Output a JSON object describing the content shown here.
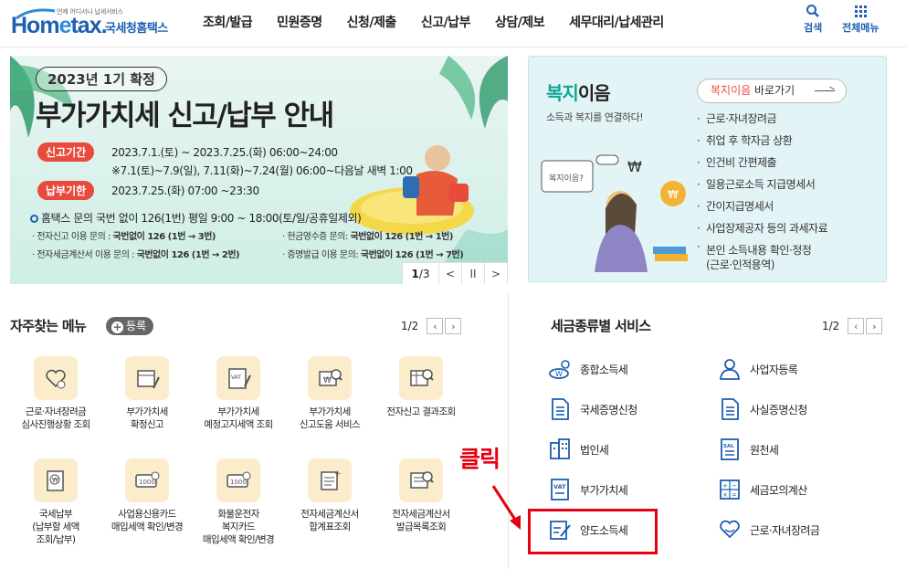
{
  "header": {
    "logo_sub": "언제 어디서나 납세서비스",
    "logo_main_a": "Hom",
    "logo_main_e": "e",
    "logo_main_b": "tax.",
    "logo_kr": "국세청홈택스",
    "nav": [
      "조회/발급",
      "민원증명",
      "신청/제출",
      "신고/납부",
      "상담/제보",
      "세무대리/납세관리"
    ],
    "search_label": "검색",
    "all_menu_label": "전체메뉴"
  },
  "banner": {
    "year": "2023년 1기 확정",
    "title": "부가가치세 신고/납부 안내",
    "period_tag": "신고기간",
    "period_line1": "2023.7.1.(토) ~ 2023.7.25.(화) 06:00~24:00",
    "period_line2": "※7.1(토)~7.9(일), 7.11(화)~7.24(월) 06:00~다음날 새벽 1:00",
    "due_tag": "납부기한",
    "due_line": "2023.7.25.(화) 07:00 ~23:30",
    "inquiry": "홈택스 문의 국번 없이 126(1번) 평일 9:00 ~ 18:00(토/일/공휴일제외)",
    "sub1_left_label": "전자신고 이용 문의 : ",
    "sub1_left_val": "국번없이 126 (1번 → 3번)",
    "sub1_right_label": "현금영수증 문의: ",
    "sub1_right_val": "국번없이 126 (1번 → 1번)",
    "sub2_left_label": "전자세금계산서 이용 문의 : ",
    "sub2_left_val": "국번없이 126 (1번 → 2번)",
    "sub2_right_label": "증명발급 이용 문의: ",
    "sub2_right_val": "국번없이 126 (1번 → 7번)",
    "page_current": "1",
    "page_total": "/3",
    "prev": "<",
    "pause": "II",
    "next": ">"
  },
  "welfare": {
    "title_green": "복지",
    "title_rest": "이음",
    "subtitle": "소득과 복지를 연결하다!",
    "link_red": "복지이음",
    "link_rest": " 바로가기",
    "items": [
      "근로·자녀장려금",
      "취업 후 학자금 상환",
      "인건비 간편제출",
      "일용근로소득 지급명세서",
      "간이지급명세서",
      "사업장제공자 등의 과세자료",
      "본인 소득내용 확인·정정",
      "(근로·인적용역)"
    ]
  },
  "frequent": {
    "title": "자주찾는 메뉴",
    "add_label": "등록",
    "page": "1/2",
    "items": [
      {
        "l1": "근로·자녀장려금",
        "l2": "심사진행상황 조회",
        "l3": ""
      },
      {
        "l1": "부가가치세",
        "l2": "확정신고",
        "l3": ""
      },
      {
        "l1": "부가가치세",
        "l2": "예정고지세액 조회",
        "l3": ""
      },
      {
        "l1": "부가가치세",
        "l2": "신고도움 서비스",
        "l3": ""
      },
      {
        "l1": "전자신고 결과조회",
        "l2": "",
        "l3": ""
      },
      {
        "l1": "국세납부",
        "l2": "(납부할 세액",
        "l3": "조회/납부)"
      },
      {
        "l1": "사업용신용카드",
        "l2": "매입세액 확인/변경",
        "l3": ""
      },
      {
        "l1": "화물운전자",
        "l2": "복지카드",
        "l3": "매입세액 확인/변경"
      },
      {
        "l1": "전자세금계산서",
        "l2": "합계표조회",
        "l3": ""
      },
      {
        "l1": "전자세금계산서",
        "l2": "발급목록조회",
        "l3": ""
      }
    ]
  },
  "services": {
    "title": "세금종류별 서비스",
    "page": "1/2",
    "left": [
      "종합소득세",
      "국세증명신청",
      "법인세",
      "부가가치세",
      "양도소득세"
    ],
    "right": [
      "사업자등록",
      "사실증명신청",
      "원천세",
      "세금모의계산",
      "근로·자녀장려금"
    ]
  },
  "annotation": {
    "click": "클릭"
  },
  "colors": {
    "brand_blue": "#1d5fb3",
    "accent_red": "#e84a3c",
    "highlight_red": "#e60012",
    "welfare_green": "#10a596"
  }
}
